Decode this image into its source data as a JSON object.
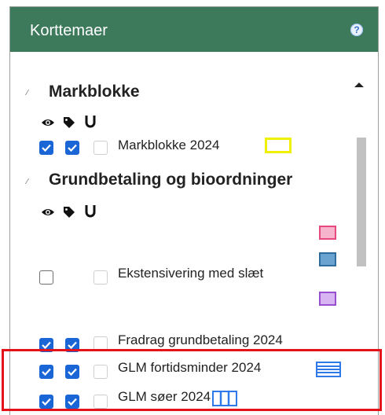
{
  "panel": {
    "title": "Korttemaer",
    "help_icon": "question-circle-icon"
  },
  "sections": [
    {
      "title": "Markblokke",
      "collapse_icon": "collapse-marker-icon",
      "toggle_icon": "caret-up-icon",
      "header_icons": [
        "eye-icon",
        "tag-icon",
        "magnet-icon"
      ]
    },
    {
      "title": "Grundbetaling og bioordninger",
      "collapse_icon": "collapse-marker-icon",
      "header_icons": [
        "eye-icon",
        "tag-icon",
        "magnet-icon"
      ]
    }
  ],
  "layers": [
    {
      "label": "Markblokke 2024",
      "visible": true,
      "labels": true,
      "snap": false,
      "legend": {
        "kind": "outline-rect",
        "color": "#f0f000"
      }
    },
    {
      "label": "Ekstensivering med slæt",
      "visible": false,
      "labels": false,
      "snap": false,
      "legend": {
        "kind": "stacked-swatches",
        "colors": [
          "#e8497d",
          "#2e6e9e",
          "#9a4fd0"
        ]
      }
    },
    {
      "label": "Fradrag grundbetaling 2024",
      "visible": true,
      "labels": true,
      "snap": false
    },
    {
      "label": "GLM fortidsminder 2024",
      "visible": true,
      "labels": true,
      "snap": false,
      "legend": {
        "kind": "horizontal-hatch",
        "color": "#2f7ae8"
      }
    },
    {
      "label": "GLM søer 2024",
      "visible": true,
      "labels": true,
      "snap": false,
      "legend": {
        "kind": "vertical-hatch",
        "color": "#2f7ae8"
      }
    }
  ],
  "highlight": {
    "color": "#e4121b"
  }
}
